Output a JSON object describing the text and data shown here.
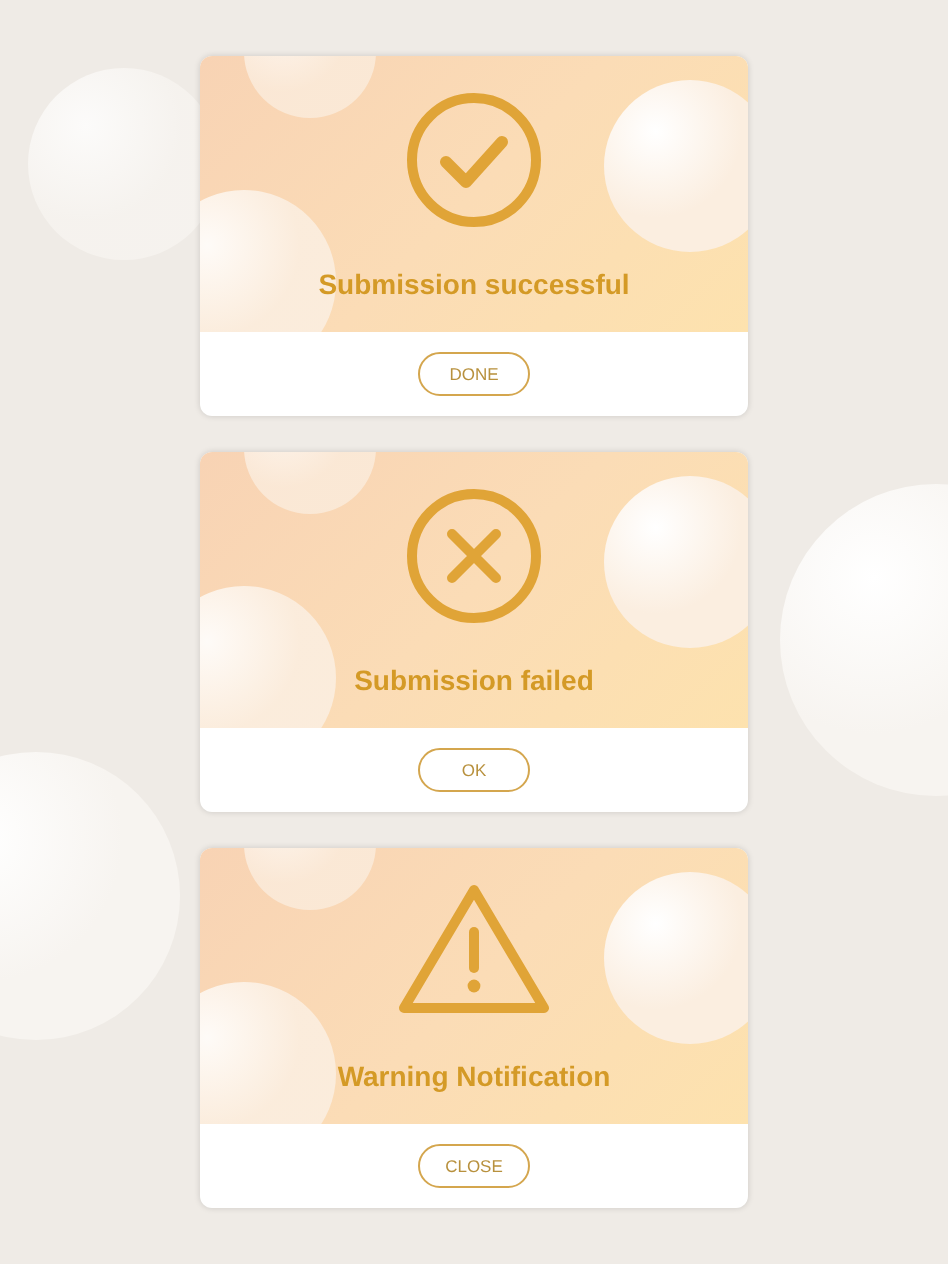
{
  "dialogs": [
    {
      "kind": "success",
      "title": "Submission successful",
      "button": "DONE"
    },
    {
      "kind": "error",
      "title": "Submission failed",
      "button": "OK"
    },
    {
      "kind": "warning",
      "title": "Warning Notification",
      "button": "CLOSE"
    }
  ]
}
